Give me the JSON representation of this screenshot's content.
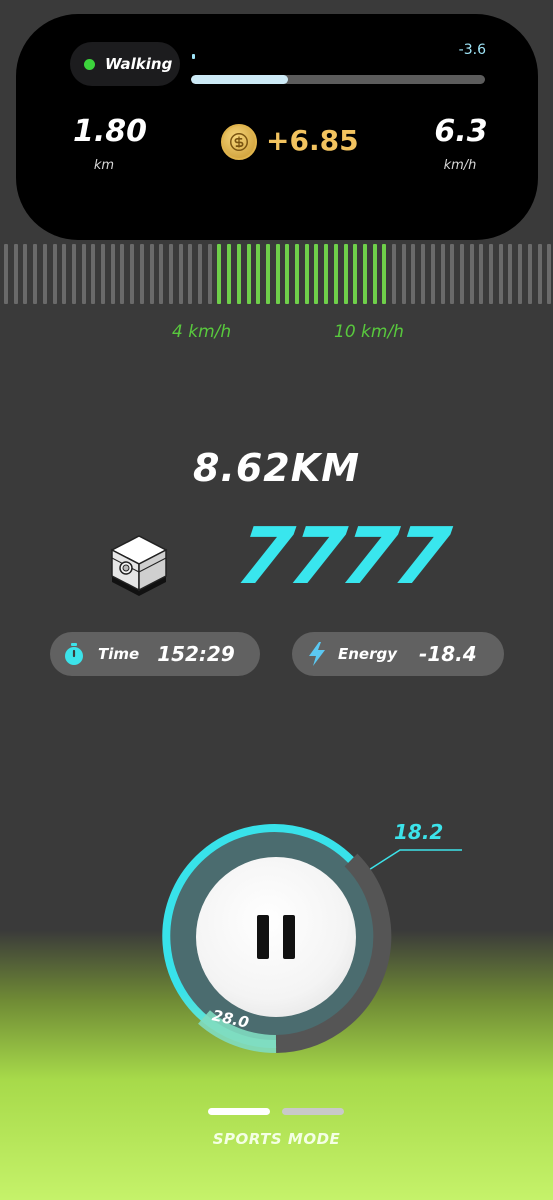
{
  "island": {
    "mode_label": "Walking",
    "mode_dot_color": "#3cd43c",
    "progress_value": "-3.6",
    "progress_fraction": 0.33,
    "distance_value": "1.80",
    "distance_unit": "km",
    "coin_icon": "coin-icon",
    "earnings": "+6.85",
    "speed_value": "6.3",
    "speed_unit": "km/h"
  },
  "ruler": {
    "min_label": "4 km/h",
    "max_label": "10 km/h",
    "active_color": "#6fd04a",
    "inactive_color": "#6a6a6a"
  },
  "totals": {
    "distance": "8.62KM",
    "box_icon": "mystery-box-icon",
    "score": "7777"
  },
  "chips": {
    "time_icon": "stopwatch-icon",
    "time_label": "Time",
    "time_value": "152:29",
    "energy_icon": "lightning-icon",
    "energy_label": "Energy",
    "energy_value": "-18.4"
  },
  "control": {
    "ring_top_value": "18.2",
    "ring_bottom_value": "28.0",
    "ring_color": "#38e2ea",
    "pause_icon": "pause-icon"
  },
  "footer": {
    "page_count": 2,
    "active_page": 1,
    "mode_title": "SPORTS MODE"
  },
  "colors": {
    "accent_cyan": "#39e6ee",
    "accent_gold": "#f2c35f",
    "accent_green": "#6fd04a"
  }
}
